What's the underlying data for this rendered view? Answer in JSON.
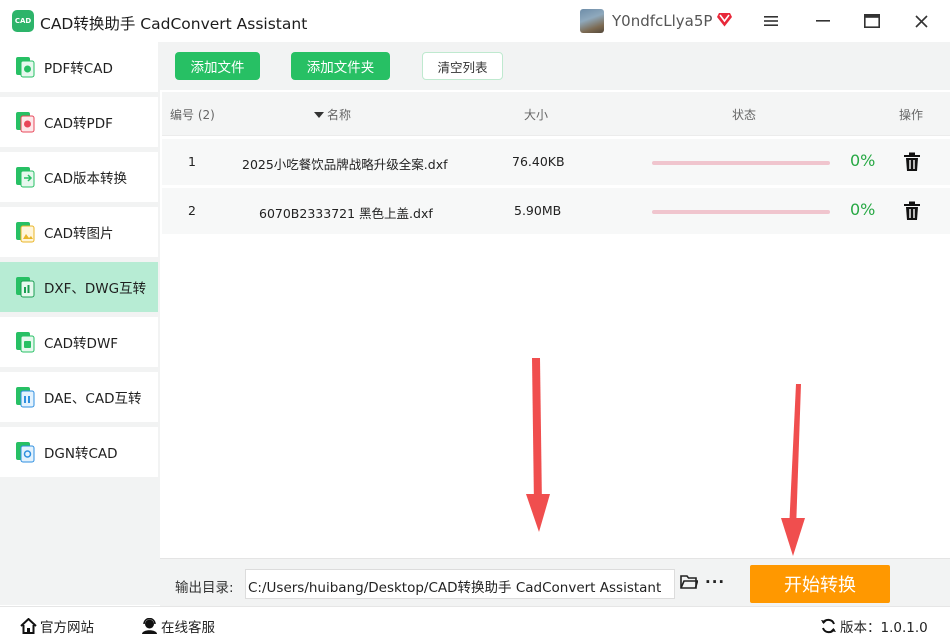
{
  "titlebar": {
    "logo_text": "CAD",
    "title": "CAD转换助手 CadConvert Assistant",
    "username": "Y0ndfcLlya5P"
  },
  "sidebar": {
    "items": [
      {
        "label": "PDF转CAD",
        "icon": "pdf-to-cad-icon",
        "active": false
      },
      {
        "label": "CAD转PDF",
        "icon": "cad-to-pdf-icon",
        "active": false
      },
      {
        "label": "CAD版本转换",
        "icon": "cad-version-icon",
        "active": false
      },
      {
        "label": "CAD转图片",
        "icon": "cad-to-image-icon",
        "active": false
      },
      {
        "label": "DXF、DWG互转",
        "icon": "dxf-dwg-icon",
        "active": true
      },
      {
        "label": "CAD转DWF",
        "icon": "cad-to-dwf-icon",
        "active": false
      },
      {
        "label": "DAE、CAD互转",
        "icon": "dae-cad-icon",
        "active": false
      },
      {
        "label": "DGN转CAD",
        "icon": "dgn-to-cad-icon",
        "active": false
      }
    ]
  },
  "toolbar": {
    "add_file": "添加文件",
    "add_folder": "添加文件夹",
    "clear_list": "清空列表"
  },
  "table": {
    "headers": {
      "index": "编号 (2)",
      "name": "名称",
      "size": "大小",
      "status": "状态",
      "action": "操作"
    },
    "rows": [
      {
        "index": "1",
        "name": "2025小吃餐饮品牌战略升级全案.dxf",
        "size": "76.40KB",
        "progress": "0%"
      },
      {
        "index": "2",
        "name": "6070B2333721 黑色上盖.dxf",
        "size": "5.90MB",
        "progress": "0%"
      }
    ]
  },
  "output": {
    "label": "输出目录:",
    "path": "C:/Users/huibang/Desktop/CAD转换助手 CadConvert Assistant",
    "more": "···",
    "start_button": "开始转换"
  },
  "statusbar": {
    "website": "官方网站",
    "support": "在线客服",
    "version": "版本：1.0.1.0"
  },
  "colors": {
    "accent_green": "#27c064",
    "active_sidebar": "#b7ecd4",
    "start_orange": "#ff9800",
    "annotation_arrow": "#f04e4e"
  }
}
